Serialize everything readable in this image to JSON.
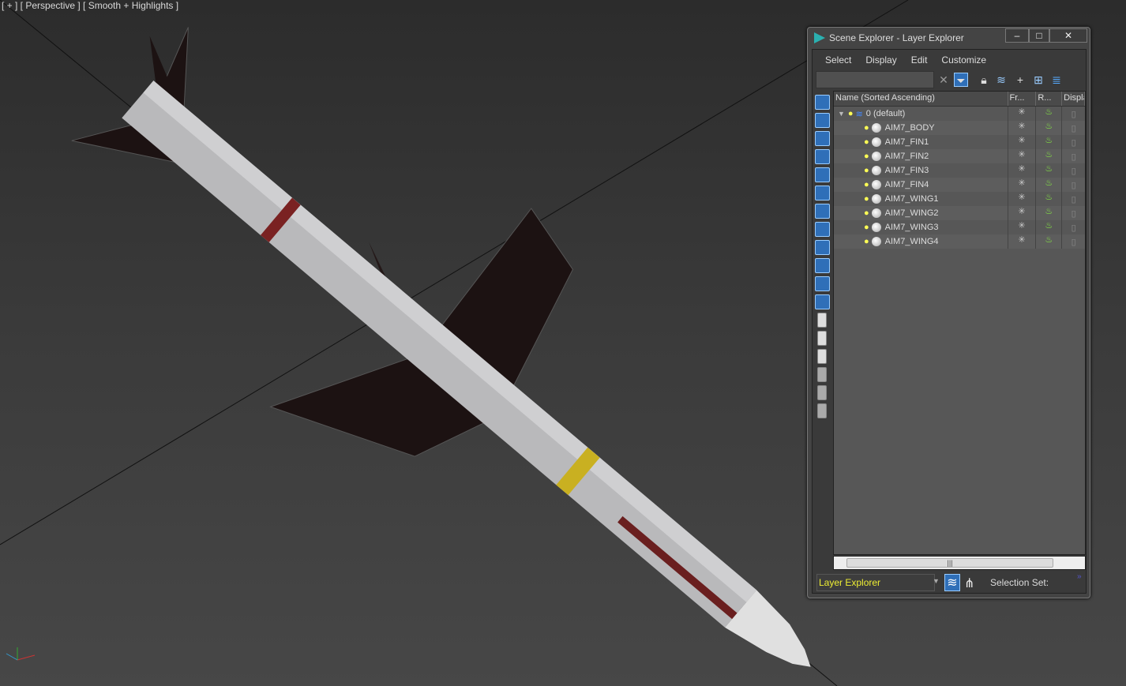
{
  "viewport": {
    "label": "[ + ] [ Perspective ] [ Smooth + Highlights ]"
  },
  "explorer": {
    "title": "Scene Explorer - Layer Explorer",
    "window_buttons": [
      "‒",
      "□",
      "✕"
    ],
    "menu": [
      "Select",
      "Display",
      "Edit",
      "Customize"
    ],
    "search_placeholder": "",
    "columns": [
      "Name (Sorted Ascending)",
      "Fr...",
      "R...",
      "Displa"
    ],
    "layer": "0 (default)",
    "objects": [
      "AIM7_BODY",
      "AIM7_FIN1",
      "AIM7_FIN2",
      "AIM7_FIN3",
      "AIM7_FIN4",
      "AIM7_WING1",
      "AIM7_WING2",
      "AIM7_WING3",
      "AIM7_WING4"
    ],
    "mode": "Layer Explorer",
    "selection_set": "Selection Set:"
  }
}
